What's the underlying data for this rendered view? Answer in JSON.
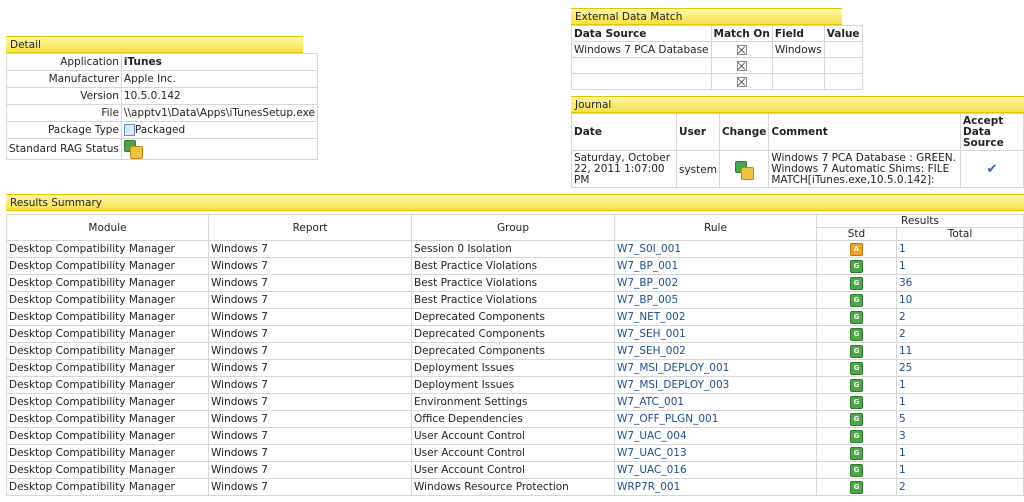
{
  "detail": {
    "title": "Detail",
    "rows": [
      {
        "label": "Application",
        "value": "iTunes"
      },
      {
        "label": "Manufacturer",
        "value": "Apple Inc."
      },
      {
        "label": "Version",
        "value": "10.5.0.142"
      },
      {
        "label": "File",
        "value": "\\\\apptv1\\Data\\Apps\\iTunesSetup.exe"
      },
      {
        "label": "Package Type",
        "value": "Packaged"
      },
      {
        "label": "Standard RAG Status",
        "value": ""
      }
    ]
  },
  "external": {
    "title": "External Data Match",
    "headers": [
      "Data Source",
      "Match On",
      "Field",
      "Value"
    ],
    "rows": [
      {
        "source": "Windows 7 PCA Database",
        "field": "Windows",
        "value": ""
      },
      {
        "source": "",
        "field": "",
        "value": ""
      },
      {
        "source": "",
        "field": "",
        "value": ""
      }
    ]
  },
  "journal": {
    "title": "Journal",
    "headers": [
      "Date",
      "User",
      "Change",
      "Comment",
      "Accept Data Source"
    ],
    "row": {
      "date": "Saturday, October 22, 2011 1:07:00 PM",
      "user": "system",
      "comment": "Windows 7 PCA Database : GREEN. Windows 7 Automatic Shims: FILE MATCH[iTunes.exe,10.5.0.142]:"
    }
  },
  "results": {
    "title": "Results Summary",
    "headers": {
      "module": "Module",
      "report": "Report",
      "group": "Group",
      "rule": "Rule",
      "results": "Results",
      "std": "Std",
      "total": "Total"
    },
    "rows": [
      {
        "module": "Desktop Compatibility Manager",
        "report": "Windows 7",
        "group": "Session 0 Isolation",
        "rule": "W7_S0I_001",
        "std": "A",
        "total": "1"
      },
      {
        "module": "Desktop Compatibility Manager",
        "report": "Windows 7",
        "group": "Best Practice Violations",
        "rule": "W7_BP_001",
        "std": "G",
        "total": "1"
      },
      {
        "module": "Desktop Compatibility Manager",
        "report": "Windows 7",
        "group": "Best Practice Violations",
        "rule": "W7_BP_002",
        "std": "G",
        "total": "36"
      },
      {
        "module": "Desktop Compatibility Manager",
        "report": "Windows 7",
        "group": "Best Practice Violations",
        "rule": "W7_BP_005",
        "std": "G",
        "total": "10"
      },
      {
        "module": "Desktop Compatibility Manager",
        "report": "Windows 7",
        "group": "Deprecated Components",
        "rule": "W7_NET_002",
        "std": "G",
        "total": "2"
      },
      {
        "module": "Desktop Compatibility Manager",
        "report": "Windows 7",
        "group": "Deprecated Components",
        "rule": "W7_SEH_001",
        "std": "G",
        "total": "2"
      },
      {
        "module": "Desktop Compatibility Manager",
        "report": "Windows 7",
        "group": "Deprecated Components",
        "rule": "W7_SEH_002",
        "std": "G",
        "total": "11"
      },
      {
        "module": "Desktop Compatibility Manager",
        "report": "Windows 7",
        "group": "Deployment Issues",
        "rule": "W7_MSI_DEPLOY_001",
        "std": "G",
        "total": "25"
      },
      {
        "module": "Desktop Compatibility Manager",
        "report": "Windows 7",
        "group": "Deployment Issues",
        "rule": "W7_MSI_DEPLOY_003",
        "std": "G",
        "total": "1"
      },
      {
        "module": "Desktop Compatibility Manager",
        "report": "Windows 7",
        "group": "Environment Settings",
        "rule": "W7_ATC_001",
        "std": "G",
        "total": "1"
      },
      {
        "module": "Desktop Compatibility Manager",
        "report": "Windows 7",
        "group": "Office Dependencies",
        "rule": "W7_OFF_PLGN_001",
        "std": "G",
        "total": "5"
      },
      {
        "module": "Desktop Compatibility Manager",
        "report": "Windows 7",
        "group": "User Account Control",
        "rule": "W7_UAC_004",
        "std": "G",
        "total": "3"
      },
      {
        "module": "Desktop Compatibility Manager",
        "report": "Windows 7",
        "group": "User Account Control",
        "rule": "W7_UAC_013",
        "std": "G",
        "total": "1"
      },
      {
        "module": "Desktop Compatibility Manager",
        "report": "Windows 7",
        "group": "User Account Control",
        "rule": "W7_UAC_016",
        "std": "G",
        "total": "1"
      },
      {
        "module": "Desktop Compatibility Manager",
        "report": "Windows 7",
        "group": "Windows Resource Protection",
        "rule": "WRP7R_001",
        "std": "G",
        "total": "2"
      }
    ]
  }
}
